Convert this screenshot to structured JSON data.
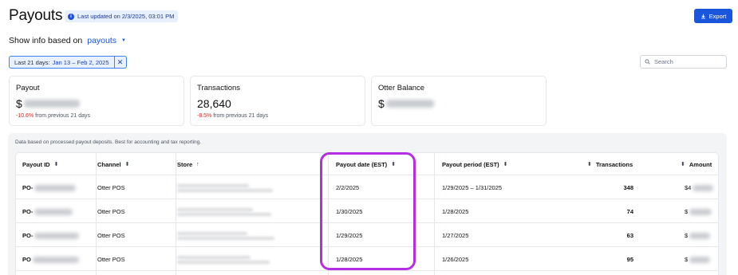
{
  "header": {
    "title": "Payouts",
    "last_updated": "Last updated on 2/3/2025, 03:01 PM",
    "export_label": "Export"
  },
  "filters": {
    "info_label": "Show info based on",
    "info_value": "payouts",
    "date_chip_prefix": "Last 21 days:",
    "date_chip_range": "Jan 13 – Feb 2, 2025"
  },
  "search": {
    "placeholder": "Search"
  },
  "cards": [
    {
      "title": "Payout",
      "value_prefix": "$",
      "change": "-10.6%",
      "change_suffix": " from previous 21 days"
    },
    {
      "title": "Transactions",
      "value": "28,640",
      "change": "-8.5%",
      "change_suffix": " from previous 21 days"
    },
    {
      "title": "Otter Balance",
      "value_prefix": "$"
    }
  ],
  "table": {
    "note": "Data based on processed payout deposits. Best for accounting and tax reporting.",
    "columns": {
      "payout_id": "Payout ID",
      "channel": "Channel",
      "store": "Store",
      "payout_date": "Payout date (EST)",
      "payout_period": "Payout period (EST)",
      "transactions": "Transactions",
      "amount": "Amount"
    },
    "rows": [
      {
        "id_prefix": "PO-",
        "channel": "Otter POS",
        "payout_date": "2/2/2025",
        "payout_period": "1/29/2025 – 1/31/2025",
        "transactions": "348",
        "amount_prefix": "$4"
      },
      {
        "id_prefix": "PO-",
        "channel": "Otter POS",
        "payout_date": "1/30/2025",
        "payout_period": "1/28/2025",
        "transactions": "74",
        "amount_prefix": "$"
      },
      {
        "id_prefix": "PO-",
        "channel": "Otter POS",
        "payout_date": "1/29/2025",
        "payout_period": "1/27/2025",
        "transactions": "63",
        "amount_prefix": "$"
      },
      {
        "id_prefix": "PO",
        "channel": "Otter POS",
        "payout_date": "1/28/2025",
        "payout_period": "1/26/2025",
        "transactions": "95",
        "amount_prefix": "$"
      }
    ]
  },
  "colors": {
    "accent": "#1a56db",
    "highlight": "#b42fe3",
    "negative": "#dc2626"
  }
}
